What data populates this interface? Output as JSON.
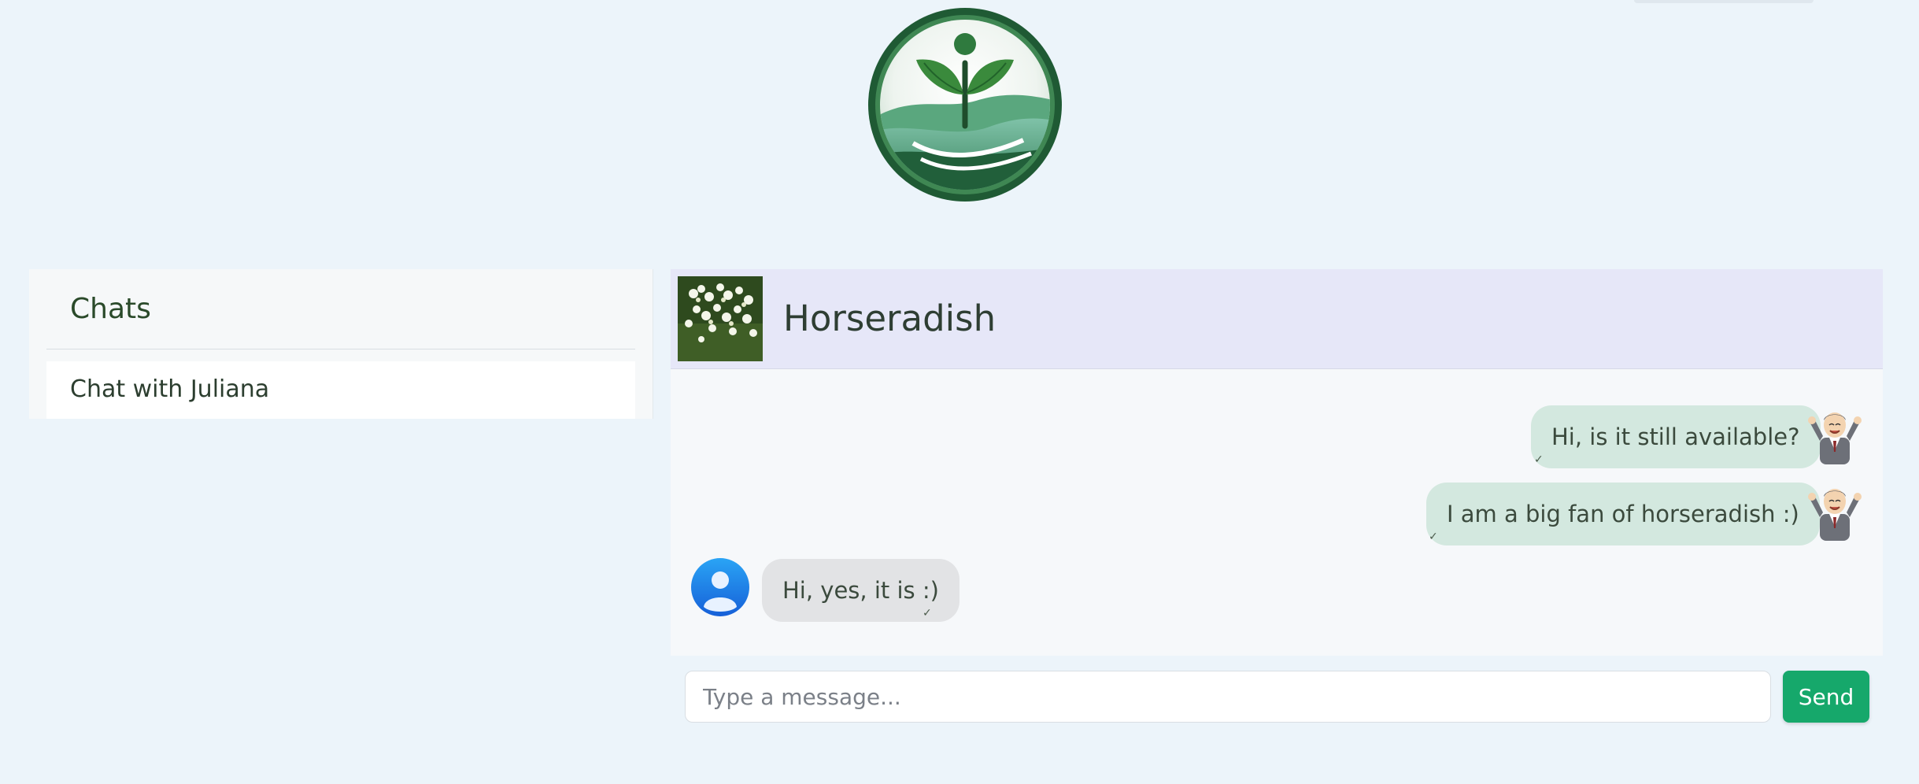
{
  "sidebar": {
    "title": "Chats",
    "items": [
      {
        "label": "Chat with Juliana"
      }
    ]
  },
  "chat": {
    "title": "Horseradish",
    "messages": [
      {
        "direction": "outgoing",
        "text": "Hi, is it still available?"
      },
      {
        "direction": "outgoing",
        "text": "I am a big fan of horseradish :)"
      },
      {
        "direction": "incoming",
        "text": "Hi, yes, it is :)"
      }
    ],
    "read_tick": "✓"
  },
  "composer": {
    "placeholder": "Type a message...",
    "send_label": "Send"
  },
  "colors": {
    "background": "#ecf4fa",
    "header": "#e6e7f8",
    "outgoing_bubble": "#d3e8df",
    "incoming_bubble": "#e2e3e5",
    "send_button": "#16a86b",
    "brand_green": "#2f7a3e"
  },
  "icons": {
    "logo": "plant-sprout-logo-icon",
    "product_thumbnail": "horseradish-flowers-thumbnail",
    "sender_avatar": "cartoon-man-avatar-icon",
    "receiver_avatar": "user-avatar-icon"
  }
}
